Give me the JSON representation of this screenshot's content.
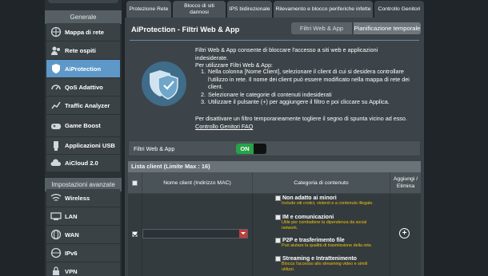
{
  "sidebar": {
    "top_label": "",
    "general_title": "Generale",
    "items": [
      {
        "label": "Mappa di rete",
        "icon": "network-map-icon"
      },
      {
        "label": "Rete ospiti",
        "icon": "guest-network-icon"
      },
      {
        "label": "AiProtection",
        "icon": "aiprotection-icon",
        "active": true
      },
      {
        "label": "QoS Adattivo",
        "icon": "qos-icon"
      },
      {
        "label": "Traffic Analyzer",
        "icon": "traffic-analyzer-icon"
      },
      {
        "label": "Game Boost",
        "icon": "gamepad-icon"
      },
      {
        "label": "Applicazioni USB",
        "icon": "usb-icon"
      },
      {
        "label": "AiCloud 2.0",
        "icon": "cloud-icon"
      }
    ],
    "advanced_title": "Impostazioni avanzate",
    "advanced_items": [
      {
        "label": "Wireless",
        "icon": "wireless-icon"
      },
      {
        "label": "LAN",
        "icon": "lan-icon"
      },
      {
        "label": "WAN",
        "icon": "wan-icon"
      },
      {
        "label": "IPv6",
        "icon": "ipv6-icon"
      },
      {
        "label": "VPN",
        "icon": "vpn-icon"
      }
    ]
  },
  "tabs": [
    {
      "label": "Protezione Rete"
    },
    {
      "label": "Blocco di siti dannosi"
    },
    {
      "label": "IPS bidirezionale"
    },
    {
      "label": "Rilevamento e blocco periferiche infette"
    },
    {
      "label": "Controllo Genitori",
      "active": true
    }
  ],
  "panel": {
    "title": "AiProtection - Filtri Web & App",
    "segments": [
      "Filtri Web & App",
      "Pianificazione temporale"
    ],
    "intro_line1": "Filtri Web & App consente di bloccare l'accesso a siti web e applicazioni indesiderate.",
    "intro_line2": "Per utilizzare Filtri Web & App:",
    "steps": [
      "Nella colonna [Nome Client], selezionare il client di cui si desidera controllare l'utilizzo in rete. Il nome dei client può essere modificato nella mappa di rete dei client.",
      "Selezionare le categorie di contenuti indesiderati",
      "Utilizzare il pulsante (+) per aggiungere il filtro e poi cliccare su Applica."
    ],
    "disable_text": "Per disattivare un filtro temporaneamente togliere il segno di spunta vicino ad esso.",
    "faq_link": "Controllo Genitori FAQ",
    "toggle_label": "Filtri Web & App",
    "toggle_state": "ON"
  },
  "list": {
    "header": "Lista client (Limite Max : 16)",
    "columns": [
      "",
      "Nome client (Indirizzo MAC)",
      "Categoria di contenuto",
      "Aggiungi / Elimina"
    ],
    "name_value": "",
    "categories": [
      {
        "name": "Non adatto ai minori",
        "desc": "Include siti crotici, violenti e a contenuto illegale."
      },
      {
        "name": "IM e comunicazioni",
        "desc": "Utile per combattere la dipendenza da social network."
      },
      {
        "name": "P2P e trasferimento file",
        "desc": "Può aiutare la qualità di trasmissione della rete."
      },
      {
        "name": "Streaming e Intrattenimento",
        "desc": "Blocca l'accesso allo streaming video e simili utilizzi."
      }
    ]
  },
  "colors": {
    "accent": "#5d98c8",
    "on": "#28a24a",
    "warning": "#f2c300"
  }
}
